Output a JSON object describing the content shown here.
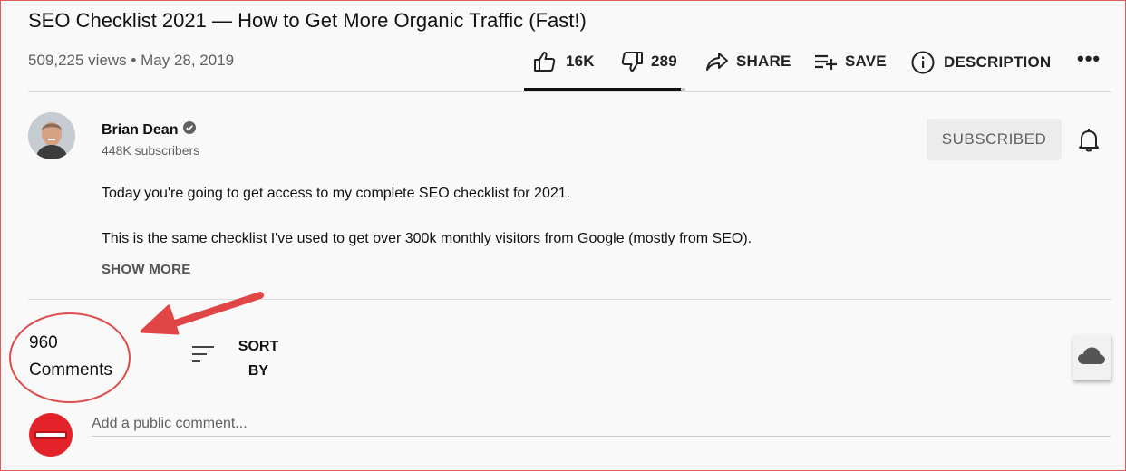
{
  "video": {
    "title": "SEO Checklist 2021 — How to Get More Organic Traffic (Fast!)",
    "views": "509,225 views",
    "date": "May 28, 2019",
    "meta_separator": "•"
  },
  "actions": {
    "likes": "16K",
    "dislikes": "289",
    "share_label": "SHARE",
    "save_label": "SAVE",
    "description_label": "DESCRIPTION",
    "more_label": "•••",
    "like_ratio": 0.97
  },
  "channel": {
    "name": "Brian Dean",
    "subscribers": "448K subscribers",
    "subscribe_state": "SUBSCRIBED",
    "verified": true
  },
  "description": {
    "line1": "Today you're going to get access to my complete SEO checklist for 2021.",
    "line2": "This is the same checklist I've used to get over 300k monthly visitors from Google (mostly from SEO).",
    "show_more": "SHOW MORE"
  },
  "comments": {
    "count": "960",
    "count_label": "Comments",
    "sort_line1": "SORT",
    "sort_line2": "BY",
    "input_placeholder": "Add a public comment..."
  },
  "icons": [
    "thumbs-up-icon",
    "thumbs-down-icon",
    "share-icon",
    "save-playlist-icon",
    "info-icon",
    "more-icon",
    "verified-icon",
    "bell-icon",
    "sort-icon",
    "cloud-icon"
  ],
  "colors": {
    "annotation_red": "#df4a4a",
    "avatar_red": "#e4222a",
    "subscribed_bg": "#ececec"
  }
}
